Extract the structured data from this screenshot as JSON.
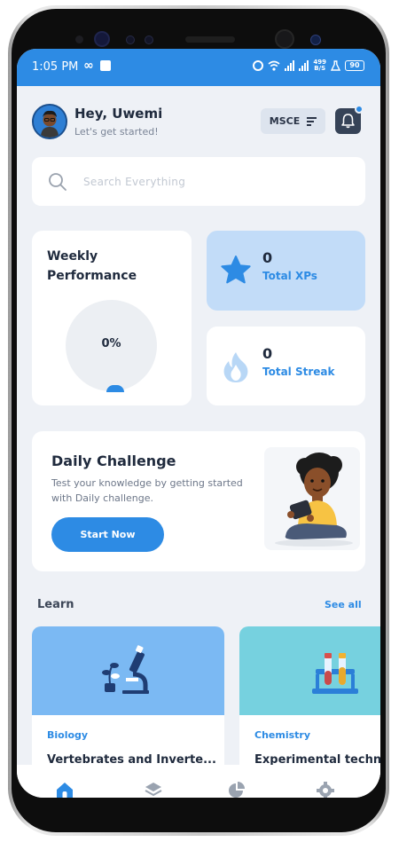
{
  "status_bar": {
    "time": "1:05 PM",
    "speed_top": "499",
    "speed_bottom": "B/S",
    "battery": "90"
  },
  "header": {
    "greeting": "Hey, Uwemi",
    "subtitle": "Let's get started!",
    "exam_selector": "MSCE",
    "has_notification": true
  },
  "search": {
    "placeholder": "Search Everything",
    "value": ""
  },
  "weekly_performance": {
    "title": "Weekly Performance",
    "percent_label": "0%",
    "progress": 0
  },
  "stats": {
    "xp": {
      "value": "0",
      "label": "Total XPs",
      "icon": "star-icon"
    },
    "streak": {
      "value": "0",
      "label": "Total Streak",
      "icon": "flame-icon"
    }
  },
  "daily_challenge": {
    "title": "Daily Challenge",
    "description": "Test your knowledge by getting started with Daily challenge.",
    "button_label": "Start Now"
  },
  "learn": {
    "title": "Learn",
    "see_all_label": "See all",
    "courses": [
      {
        "subject": "Biology",
        "name": "Vertebrates and Inverte...",
        "icon": "microscope-icon"
      },
      {
        "subject": "Chemistry",
        "name": "Experimental techni",
        "icon": "test-tubes-icon"
      }
    ]
  },
  "bottom_nav": {
    "items": [
      "home-icon",
      "layers-icon",
      "pie-chart-icon",
      "gear-icon"
    ],
    "active": "home-icon"
  },
  "colors": {
    "primary": "#2d8be4",
    "background": "#eef1f6",
    "xp_card": "#c2dcf8",
    "text_dark": "#1f2a3d"
  }
}
